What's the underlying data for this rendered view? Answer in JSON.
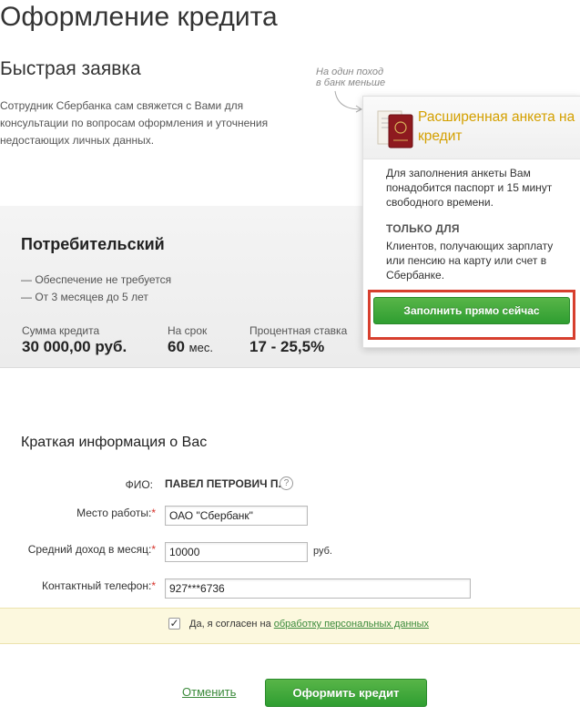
{
  "header": {
    "title": "Оформление кредита"
  },
  "quick_request": {
    "title": "Быстрая заявка",
    "description": "Сотрудник Сбербанка сам свяжется с Вами для консультации по вопросам оформления и уточнения недостающих личных данных."
  },
  "promo": {
    "hint_line1": "На один поход",
    "hint_line2": "в банк меньше",
    "title": "Расширенная анкета на кредит",
    "time_note": "Для заполнения анкеты Вам понадобится паспорт и 15 минут свободного времени.",
    "only_for": "ТОЛЬКО ДЛЯ",
    "audience": "Клиентов, получающих зарплату или пенсию на карту или счет в Сбербанке.",
    "fill_button": "Заполнить прямо сейчас",
    "icon": "passport-icon"
  },
  "product": {
    "name": "Потребительский",
    "features": [
      "— Обеспечение не требуется",
      "— От 3 месяцев до 5 лет"
    ],
    "amount": {
      "label": "Сумма кредита",
      "value": "30 000,00 руб."
    },
    "term": {
      "label": "На срок",
      "value": "60",
      "unit": "мес."
    },
    "rate": {
      "label": "Процентная ставка",
      "value": "17 - 25,5%"
    }
  },
  "form": {
    "section_title": "Краткая информация о Вас",
    "fio": {
      "label": "ФИО:",
      "value": "ПАВЕЛ ПЕТРОВИЧ П.",
      "help": "?"
    },
    "workplace": {
      "label": "Место работы:",
      "value": "ОАО \"Сбербанк\""
    },
    "income": {
      "label": "Средний доход в месяц:",
      "value": "10000",
      "currency": "руб."
    },
    "phone": {
      "label": "Контактный телефон:",
      "value": "927***6736"
    },
    "required_mark": "*"
  },
  "consent": {
    "checked": true,
    "check_mark": "✓",
    "text": "Да, я согласен на",
    "link": "обработку персональных данных"
  },
  "actions": {
    "cancel": "Отменить",
    "submit": "Оформить кредит"
  },
  "colors": {
    "accent_green": "#2f9e31",
    "promo_title": "#d4a000",
    "highlight_red": "#d73f2e",
    "consent_bg": "#fcf8de"
  }
}
